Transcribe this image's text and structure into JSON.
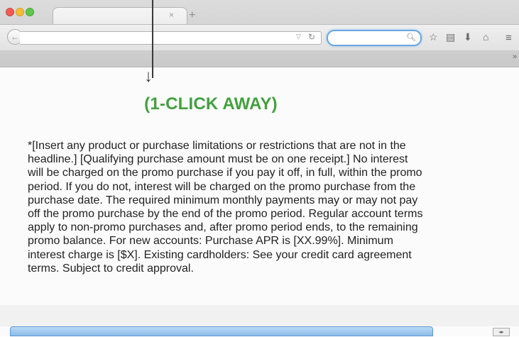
{
  "browser": {
    "tab_close_glyph": "×",
    "new_tab_glyph": "+",
    "back_glyph": "←",
    "url_value": "",
    "search_value": "",
    "icons": [
      "back-arrow-icon",
      "reload-icon",
      "search-icon",
      "star-icon",
      "bookmarks-icon",
      "download-icon",
      "home-icon",
      "menu-icon",
      "chevron-right-icon"
    ]
  },
  "annotation": {
    "arrow_head": "↓"
  },
  "content": {
    "headline": "(1-CLICK AWAY)",
    "headline_color": "#43a03f",
    "disclaimer_lines": [
      "*[Insert any product or purchase limitations or restrictions that are not in the",
      "headline.] [Qualifying purchase amount must be on one receipt.] No interest",
      "will be charged on the promo purchase if you pay it off, in full, within the promo",
      "period. If you do not, interest will be charged on the promo purchase from the",
      "purchase date. The required minimum monthly payments may or may not pay",
      "off the promo purchase by the end of the promo period. Regular account terms",
      "apply to non-promo purchases and, after promo period ends, to the remaining",
      "promo balance. For new accounts: Purchase APR is [XX.99%]. Minimum",
      "interest charge is [$X]. Existing cardholders: See your credit card agreement",
      "terms. Subject to credit approval."
    ]
  }
}
